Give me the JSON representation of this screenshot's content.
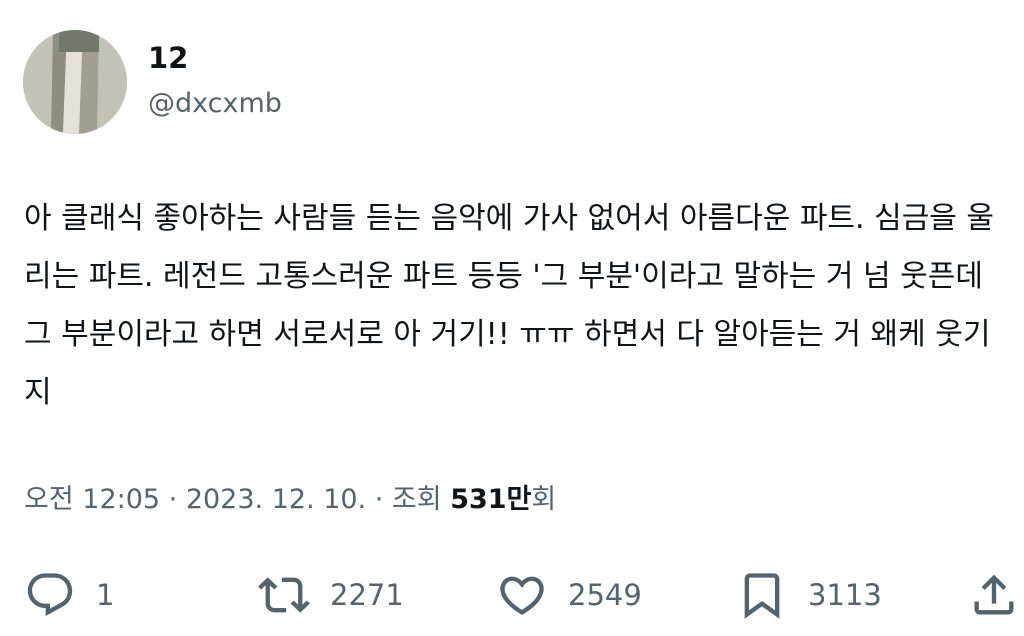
{
  "user": {
    "display_name": "12",
    "handle": "@dxcxmb"
  },
  "tweet": {
    "text": "아 클래식 좋아하는 사람들 듣는 음악에 가사 없어서 아름다운 파트. 심금을 울리는 파트. 레전드 고통스러운 파트 등등 '그 부분'이라고 말하는 거 넘 웃픈데 그 부분이라고 하면 서로서로 아 거기!! ㅠㅠ 하면서 다 알아듣는 거 왜케 웃기지"
  },
  "meta": {
    "time": "오전 12:05",
    "separator1": " · ",
    "date": "2023. 12. 10.",
    "separator2": " · ",
    "views_label": "조회 ",
    "views_count": "531만",
    "views_suffix": "회"
  },
  "actions": {
    "reply_count": "1",
    "retweet_count": "2271",
    "like_count": "2549",
    "bookmark_count": "3113"
  },
  "icons": {
    "reply": "reply-icon",
    "retweet": "retweet-icon",
    "like": "heart-icon",
    "bookmark": "bookmark-icon",
    "share": "share-icon"
  },
  "colors": {
    "text": "#0f1419",
    "secondary": "#536471",
    "background": "#ffffff"
  }
}
